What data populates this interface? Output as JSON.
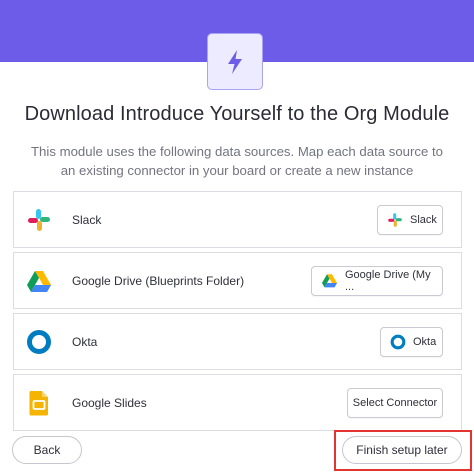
{
  "header": {
    "accent_color": "#6c5ce7",
    "badge_icon": "lightning-bolt-icon"
  },
  "title": "Download Introduce Yourself to the Org Module",
  "subtitle": "This module uses the following data sources. Map each data source to an existing connector in your board or create a new instance",
  "sources": [
    {
      "name": "Slack",
      "icon": "slack-icon",
      "connector": "Slack",
      "connector_icon": "slack-icon"
    },
    {
      "name": "Google Drive (Blueprints Folder)",
      "icon": "google-drive-icon",
      "connector": "Google Drive (My ...",
      "connector_icon": "google-drive-icon"
    },
    {
      "name": "Okta",
      "icon": "okta-icon",
      "connector": "Okta",
      "connector_icon": "okta-icon"
    },
    {
      "name": "Google Slides",
      "icon": "google-slides-icon",
      "connector": "Select Connector"
    }
  ],
  "footer": {
    "back_label": "Back",
    "finish_label": "Finish setup later",
    "highlight_color": "#e3342f"
  }
}
